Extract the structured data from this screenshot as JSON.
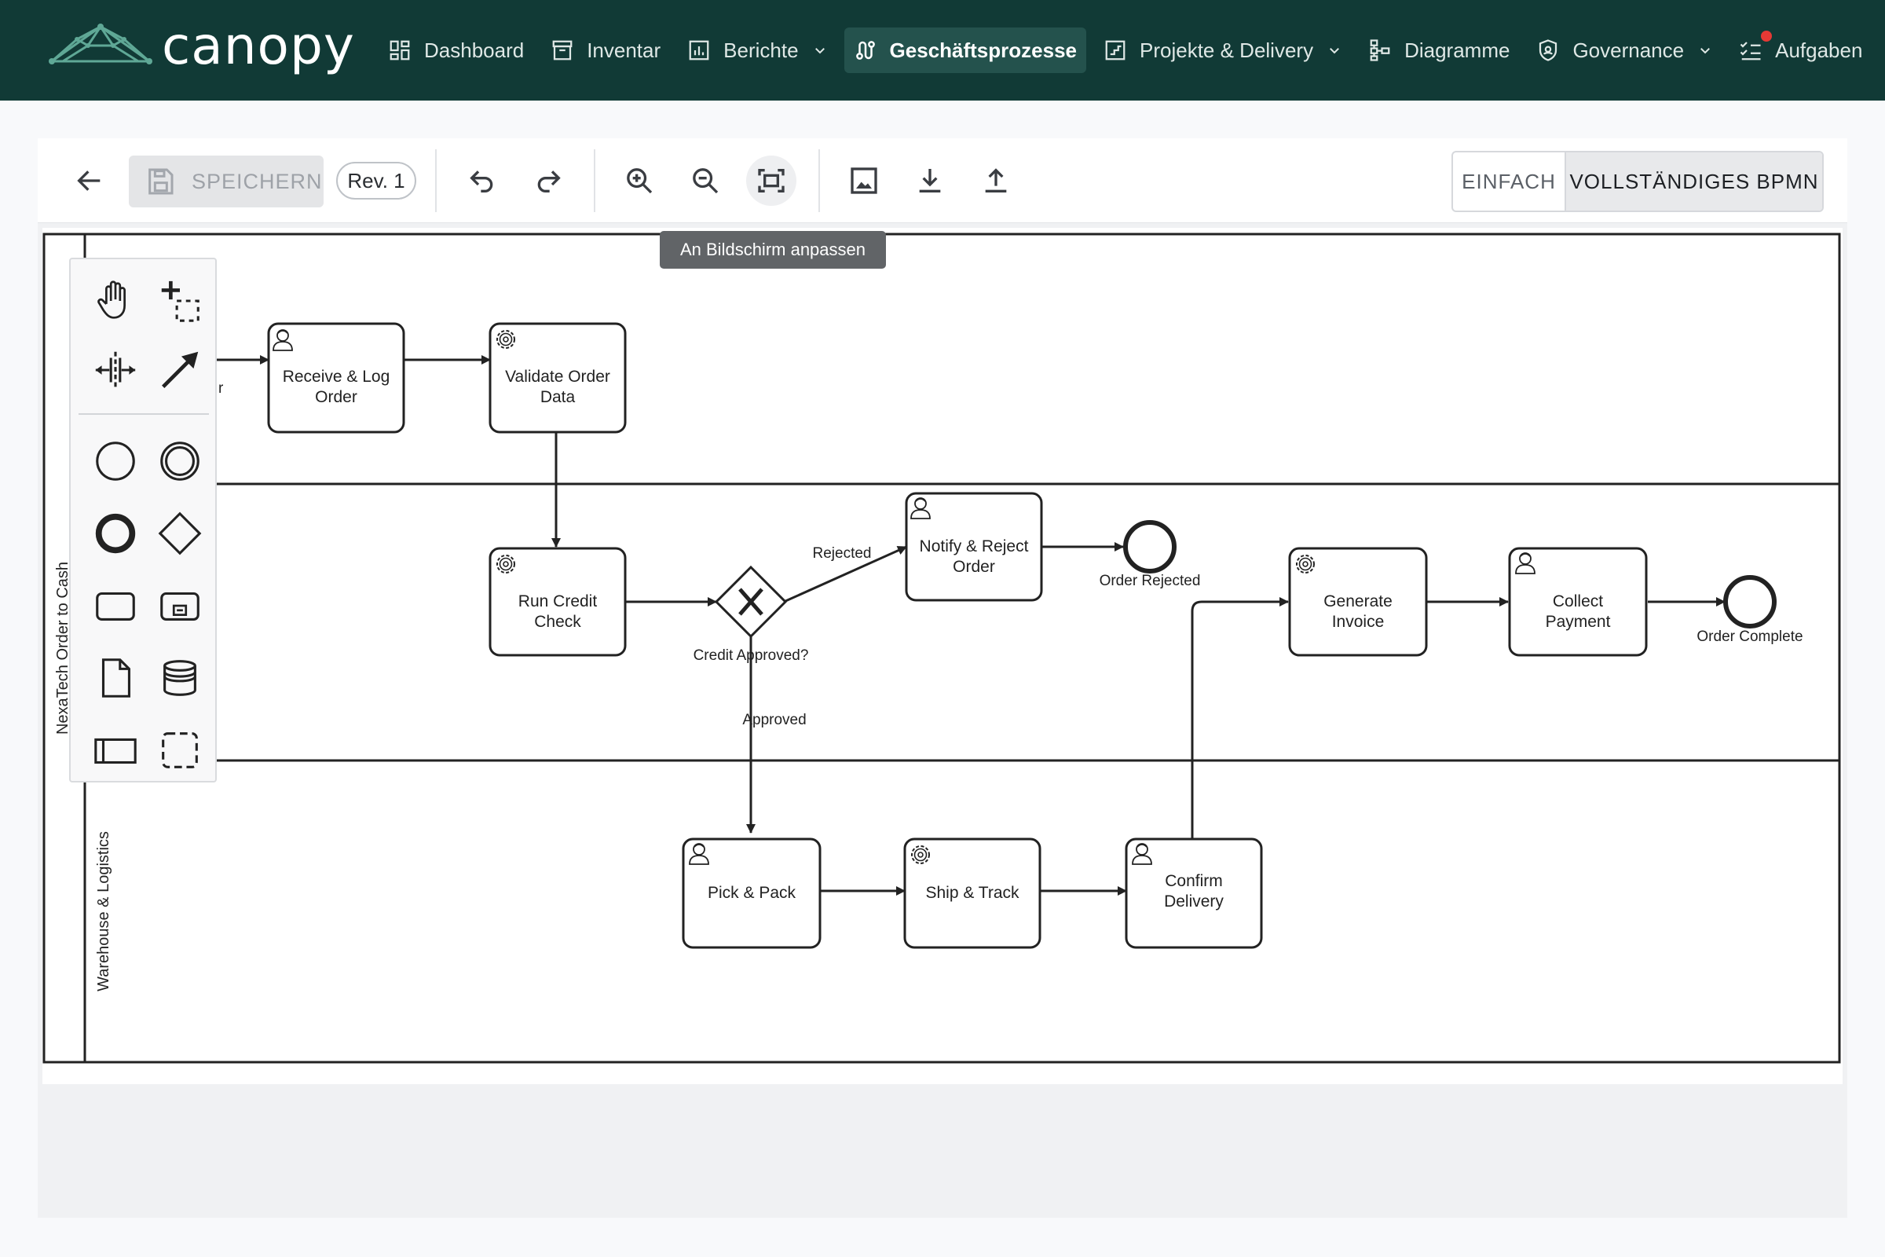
{
  "app": {
    "name": "canopy"
  },
  "nav": {
    "items": [
      {
        "label": "Dashboard",
        "icon": "dashboard-icon",
        "dropdown": false,
        "active": false
      },
      {
        "label": "Inventar",
        "icon": "archive-icon",
        "dropdown": false,
        "active": false
      },
      {
        "label": "Berichte",
        "icon": "bar-chart-icon",
        "dropdown": true,
        "active": false
      },
      {
        "label": "Geschäftsprozesse",
        "icon": "process-icon",
        "dropdown": false,
        "active": true
      },
      {
        "label": "Projekte & Delivery",
        "icon": "project-icon",
        "dropdown": true,
        "active": false
      },
      {
        "label": "Diagramme",
        "icon": "hierarchy-icon",
        "dropdown": false,
        "active": false
      },
      {
        "label": "Governance",
        "icon": "shield-icon",
        "dropdown": true,
        "active": false
      },
      {
        "label": "Aufgaben",
        "icon": "checklist-icon",
        "dropdown": false,
        "active": false,
        "notification": true
      }
    ]
  },
  "toolbar": {
    "save_label": "SPEICHERN",
    "revision_label": "Rev. 1",
    "mode_simple": "EINFACH",
    "mode_full": "VOLLSTÄNDIGES BPMN",
    "tooltip": "An Bildschirm anpassen"
  },
  "diagram": {
    "pool_label": "NexaTech Order to Cash",
    "lane_labels": [
      "Warehouse & Logistics"
    ],
    "partial_label": "r",
    "tasks": [
      {
        "name": "Receive & Log Order",
        "lines": [
          "Receive & Log",
          "Order"
        ],
        "kind": "user"
      },
      {
        "name": "Validate Order Data",
        "lines": [
          "Validate Order",
          "Data"
        ],
        "kind": "service"
      },
      {
        "name": "Run Credit Check",
        "lines": [
          "Run Credit",
          "Check"
        ],
        "kind": "service"
      },
      {
        "name": "Notify & Reject Order",
        "lines": [
          "Notify & Reject",
          "Order"
        ],
        "kind": "user"
      },
      {
        "name": "Generate Invoice",
        "lines": [
          "Generate",
          "Invoice"
        ],
        "kind": "service"
      },
      {
        "name": "Collect Payment",
        "lines": [
          "Collect",
          "Payment"
        ],
        "kind": "user"
      },
      {
        "name": "Pick & Pack",
        "lines": [
          "Pick & Pack"
        ],
        "kind": "user"
      },
      {
        "name": "Ship & Track",
        "lines": [
          "Ship & Track"
        ],
        "kind": "service"
      },
      {
        "name": "Confirm Delivery",
        "lines": [
          "Confirm",
          "Delivery"
        ],
        "kind": "user"
      }
    ],
    "gateway_label": "Credit Approved?",
    "end_events": [
      "Order Rejected",
      "Order Complete"
    ],
    "flow_labels": {
      "rejected": "Rejected",
      "approved": "Approved"
    }
  },
  "palette": {
    "tools": [
      "hand-tool-icon",
      "lasso-tool-icon",
      "space-tool-icon",
      "connect-tool-icon",
      "start-event-icon",
      "intermediate-event-icon",
      "end-event-icon",
      "gateway-icon",
      "task-icon",
      "subprocess-icon",
      "data-object-icon",
      "data-store-icon",
      "pool-icon",
      "group-icon"
    ]
  },
  "colors": {
    "topbar": "#113a36",
    "accent": "#2d7a6b",
    "notification": "#e53935"
  }
}
